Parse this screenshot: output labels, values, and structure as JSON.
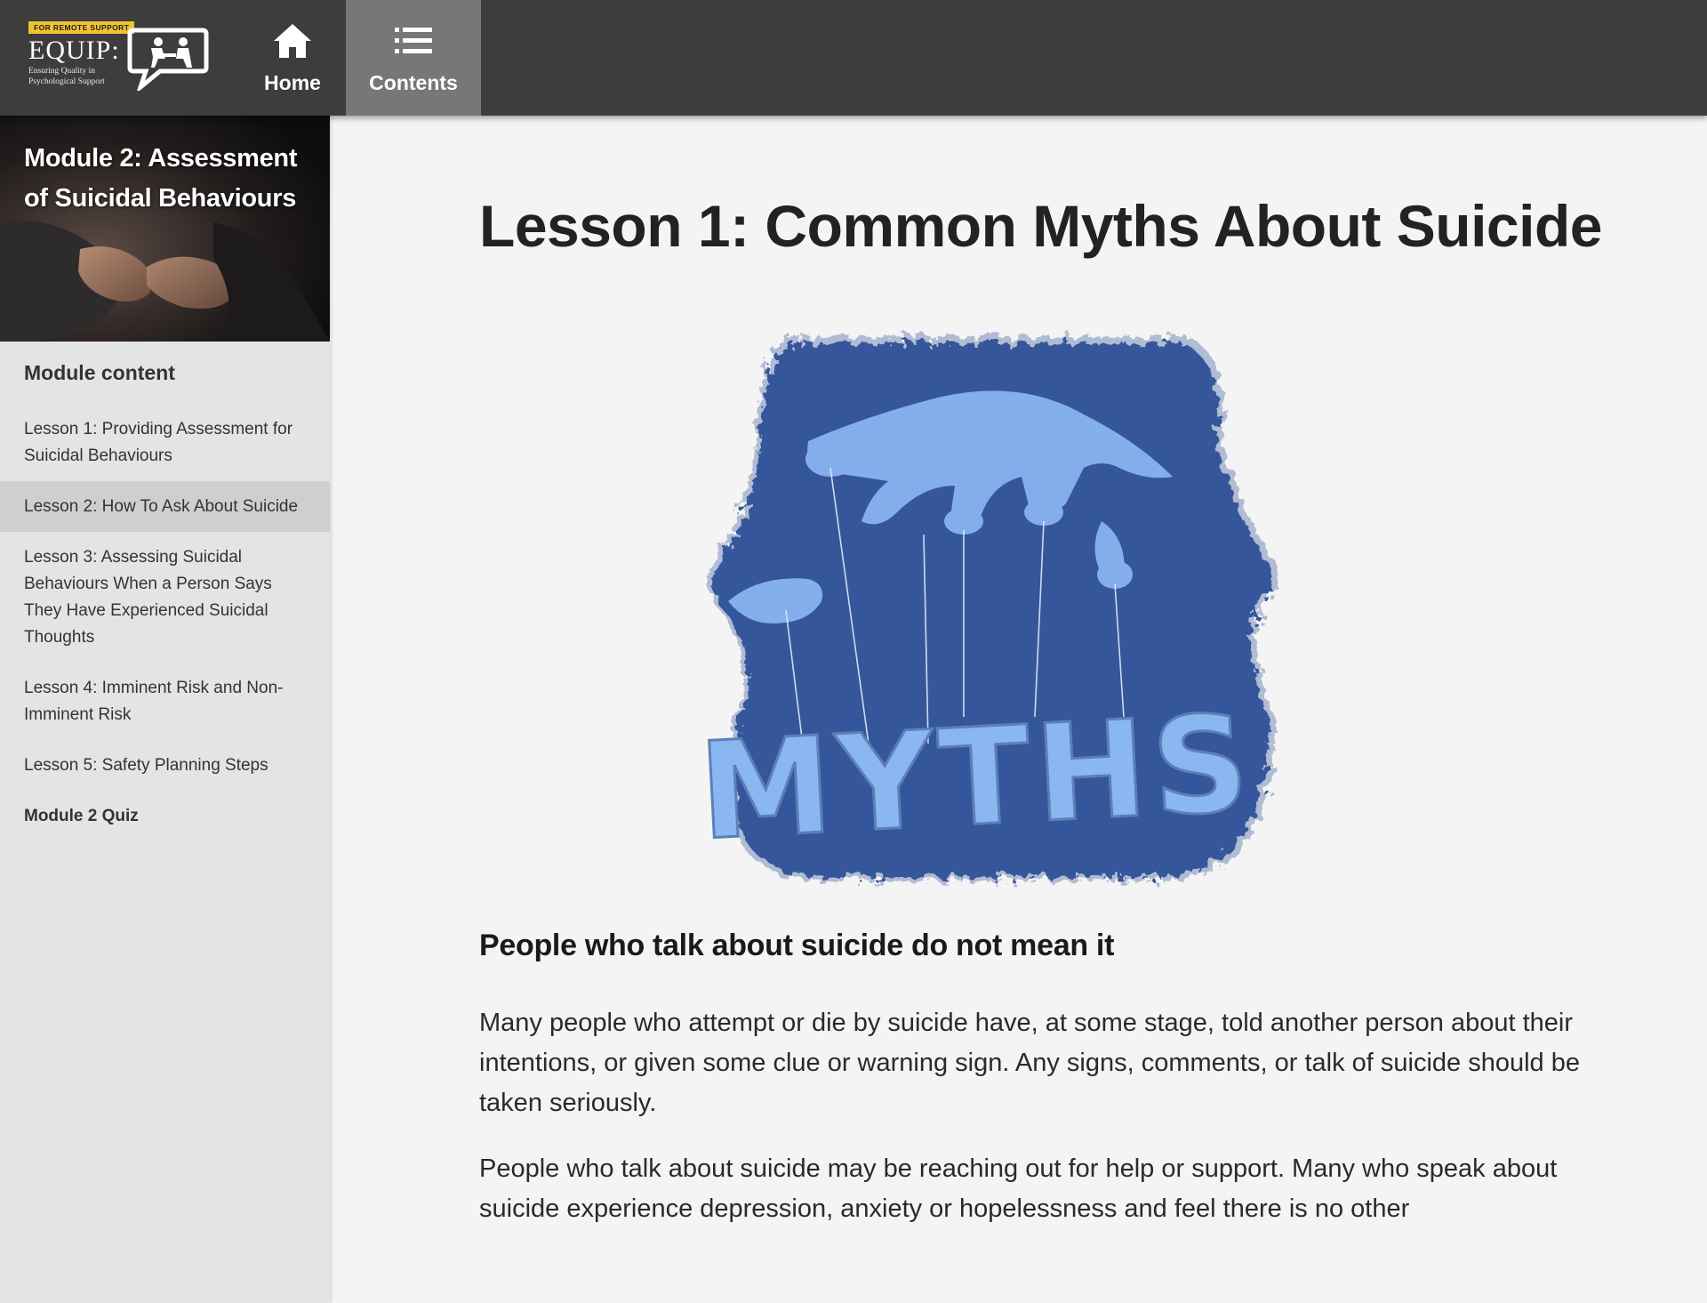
{
  "app": {
    "logo": {
      "tagline": "FOR REMOTE SUPPORT",
      "wordmark": "EQUIP:",
      "subtitle": "Ensuring Quality in Psychological Support"
    },
    "nav": {
      "home_label": "Home",
      "contents_label": "Contents"
    }
  },
  "sidebar": {
    "module_title": "Module 2: Assessment of Suicidal Behaviours",
    "content_heading": "Module content",
    "items": [
      {
        "label": "Lesson 1: Providing Assessment for Suicidal Behaviours",
        "active": false
      },
      {
        "label": "Lesson 2: How To Ask About Suicide",
        "active": true
      },
      {
        "label": "Lesson 3: Assessing Suicidal Behaviours When a Person Says They Have Experienced Suicidal Thoughts",
        "active": false
      },
      {
        "label": "Lesson 4: Imminent Risk and Non-Imminent Risk",
        "active": false
      },
      {
        "label": "Lesson 5: Safety Planning Steps",
        "active": false
      },
      {
        "label": "Module 2 Quiz",
        "active": false
      }
    ]
  },
  "main": {
    "title": "Lesson 1: Common Myths About Suicide",
    "image_text": "MYTHS",
    "heading": "People who talk about suicide do not mean it",
    "paragraphs": [
      "Many people who attempt or die by suicide have, at some stage, told another person about their intentions, or given some clue or warning sign. Any signs, comments, or talk of suicide should be taken seriously.",
      "People who talk about suicide may be reaching out for help or support. Many who speak about suicide experience depression, anxiety or hopelessness and feel there is no other"
    ]
  },
  "colors": {
    "topbar": "#3d3d3d",
    "nav_active": "#777777",
    "sidebar": "#e4e4e4",
    "sidebar_active": "#cfcfcf",
    "hero_blue": "#34579a",
    "hero_light": "#8ab6f2",
    "tag_yellow": "#f2c230"
  }
}
